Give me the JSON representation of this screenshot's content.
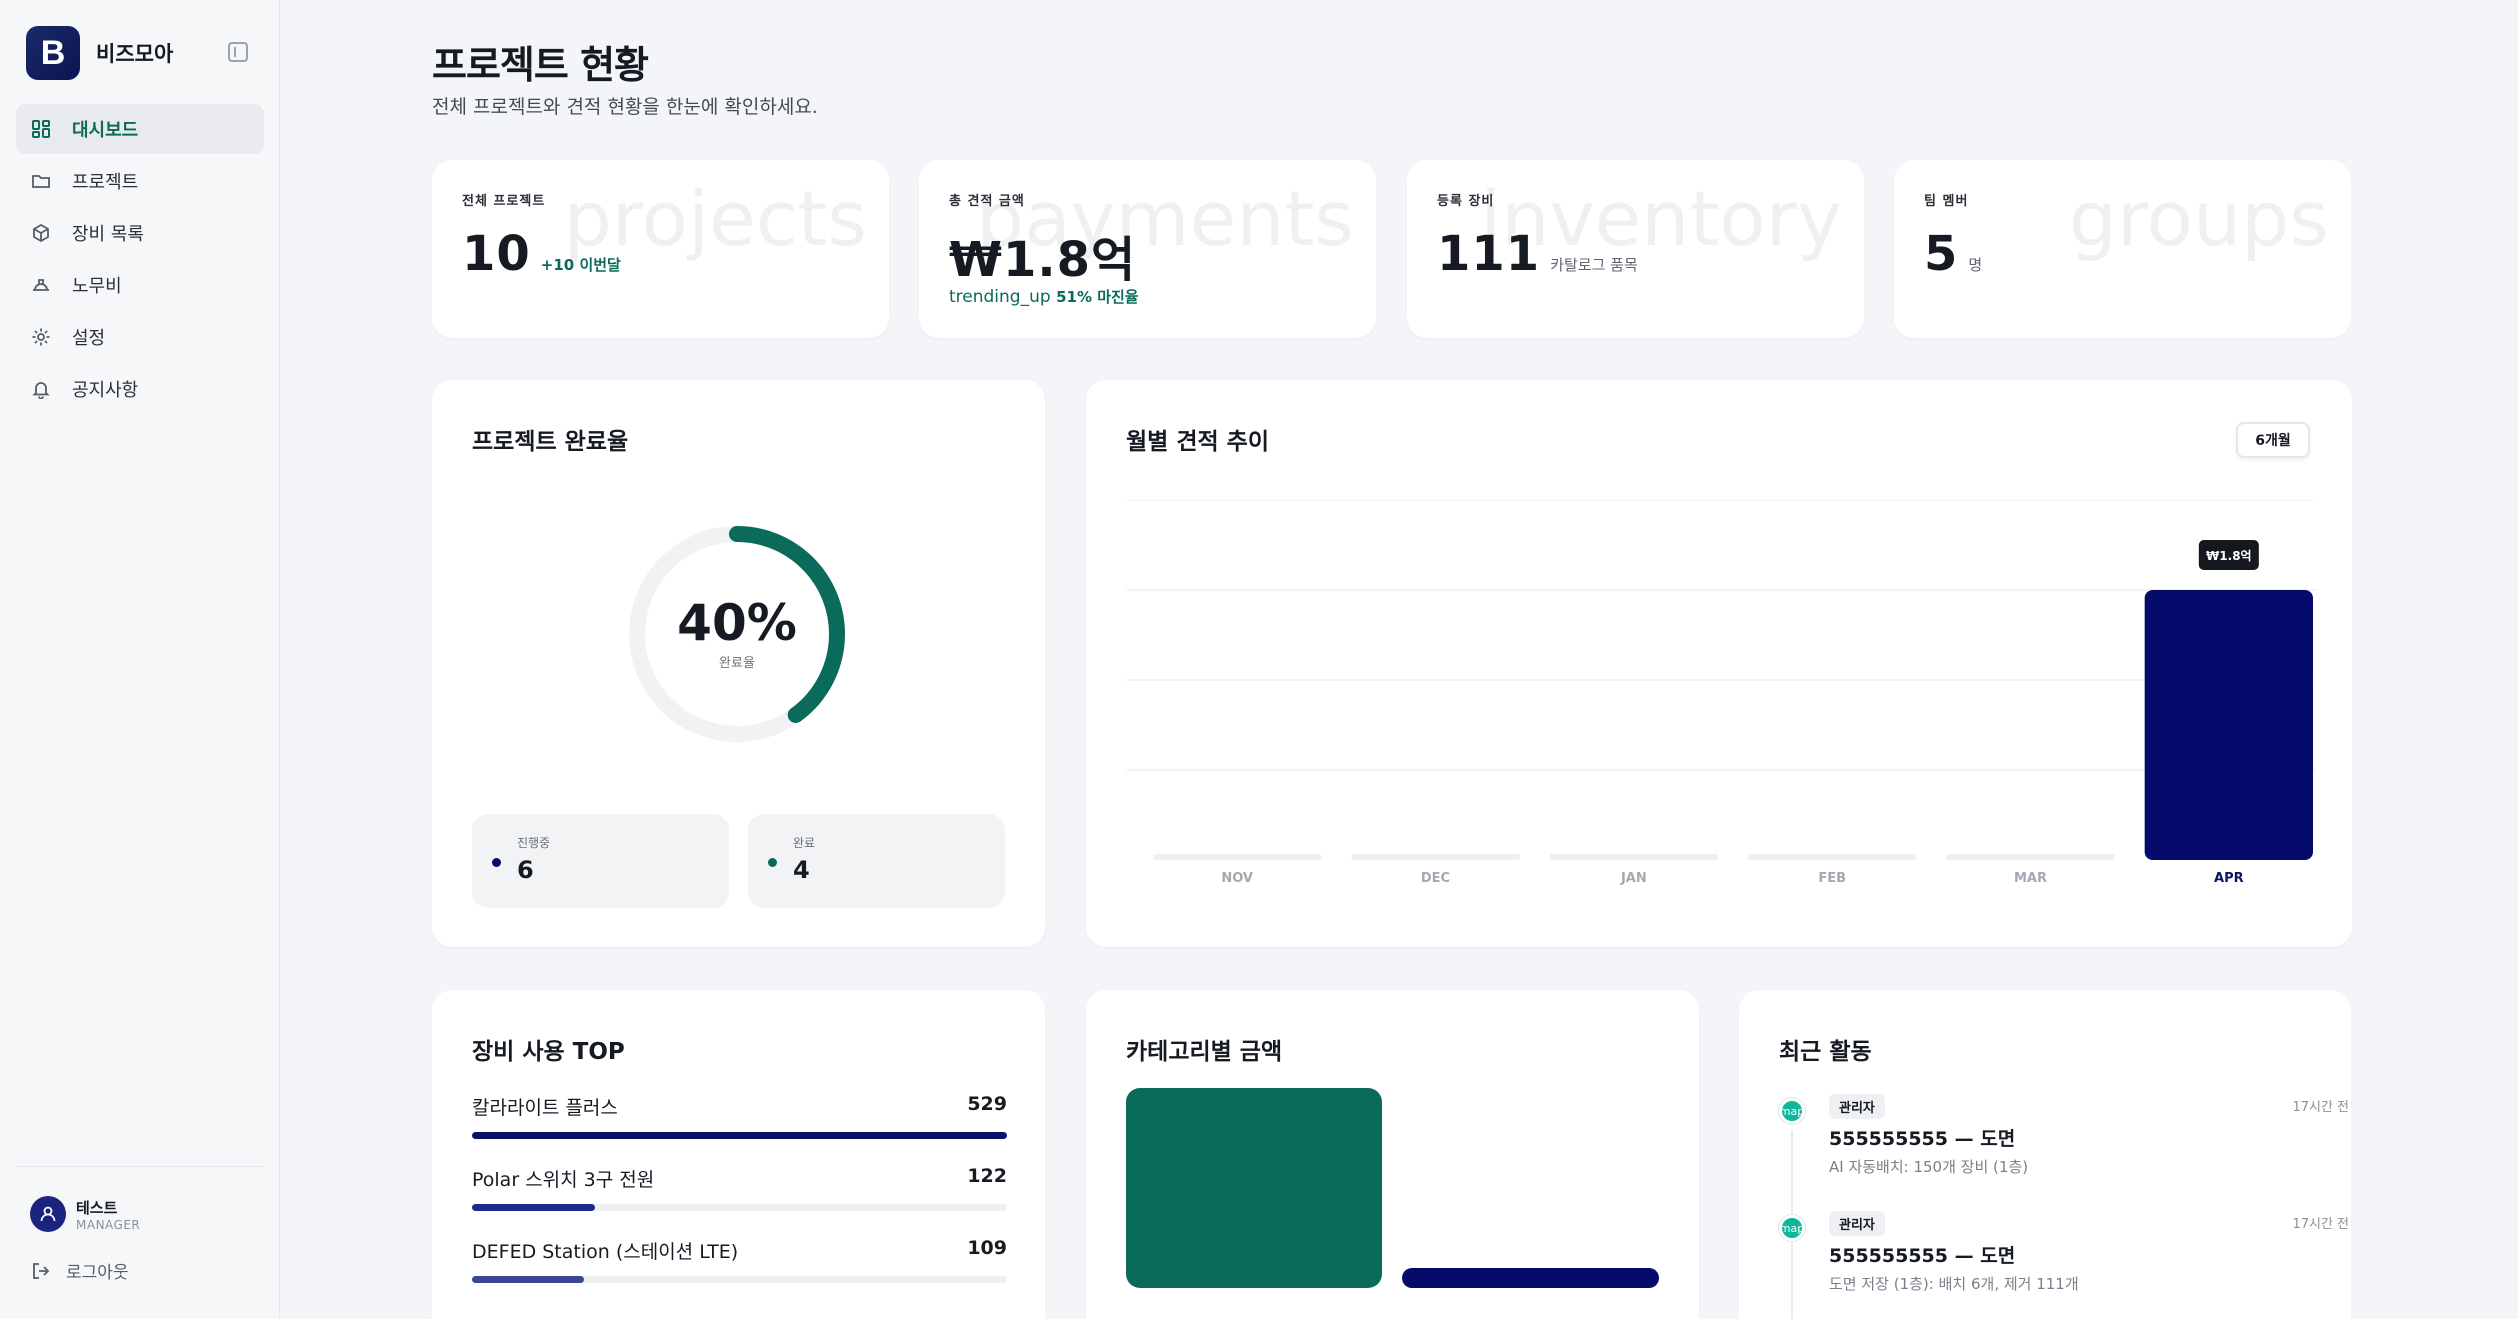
{
  "brand": {
    "logo_letter": "B",
    "name": "비즈모아"
  },
  "nav": [
    {
      "label": "대시보드",
      "icon": "dashboard-icon",
      "active": true
    },
    {
      "label": "프로젝트",
      "icon": "folder-icon"
    },
    {
      "label": "장비 목록",
      "icon": "package-icon"
    },
    {
      "label": "노무비",
      "icon": "hardhat-icon"
    },
    {
      "label": "설정",
      "icon": "gear-icon"
    },
    {
      "label": "공지사항",
      "icon": "bell-icon"
    }
  ],
  "user": {
    "name": "테스트",
    "role": "MANAGER",
    "logout": "로그아웃"
  },
  "page": {
    "title": "프로젝트 현황",
    "subtitle": "전체 프로젝트와 견적 현황을 한눈에 확인하세요."
  },
  "stats": [
    {
      "label": "전체 프로젝트",
      "bg_word": "projects",
      "value": "10",
      "sub": "+10 이번달"
    },
    {
      "label": "총 견적 금액",
      "bg_word": "payments",
      "value": "₩1.8억",
      "note_icon": "trending_up",
      "note": "51% 마진율"
    },
    {
      "label": "등록 장비",
      "bg_word": "inventory",
      "value": "111",
      "sub": "카탈로그 품목"
    },
    {
      "label": "팀 멤버",
      "bg_word": "groups",
      "value": "5",
      "sub": "명"
    }
  ],
  "completion": {
    "title": "프로젝트 완료율",
    "percent_text": "40%",
    "percent": 40,
    "center_label": "완료율",
    "in_progress_label": "진행중",
    "in_progress_value": "6",
    "done_label": "완료",
    "done_value": "4"
  },
  "monthly": {
    "title": "월별 견적 추이",
    "period": "6개월",
    "tooltip": "₩1.8억"
  },
  "chart_data": {
    "type": "bar",
    "categories": [
      "NOV",
      "DEC",
      "JAN",
      "FEB",
      "MAR",
      "APR"
    ],
    "values": [
      0,
      0,
      0,
      0,
      0,
      1.8
    ],
    "ylim": [
      0,
      2.4
    ],
    "grid": true,
    "colors": {
      "bar": "#060b6b",
      "empty": "#eef0f3"
    }
  },
  "equipment_top": {
    "title": "장비 사용 TOP",
    "items": [
      {
        "name": "칼라라이트 플러스",
        "value": "529",
        "ratio": 1.0
      },
      {
        "name": "Polar 스위치 3구 전원",
        "value": "122",
        "ratio": 0.23
      },
      {
        "name": "DEFED Station (스테이션 LTE)",
        "value": "109",
        "ratio": 0.21
      }
    ]
  },
  "category": {
    "title": "카테고리별 금액",
    "bars": [
      {
        "ratio": 1.0,
        "color": "#0b6b5a"
      },
      {
        "ratio": 0.1,
        "color": "#060b6b"
      }
    ]
  },
  "recent": {
    "title": "최근 활동",
    "items": [
      {
        "dot": "map",
        "badge": "관리자",
        "time": "17시간 전",
        "title": "555555555 — 도면",
        "desc": "AI 자동배치: 150개 장비 (1층)"
      },
      {
        "dot": "map",
        "badge": "관리자",
        "time": "17시간 전",
        "title": "555555555 — 도면",
        "desc": "도면 저장 (1층): 배치 6개, 제거 111개"
      }
    ]
  },
  "colors": {
    "accent": "#0b6b5a",
    "navy": "#060b6b"
  }
}
